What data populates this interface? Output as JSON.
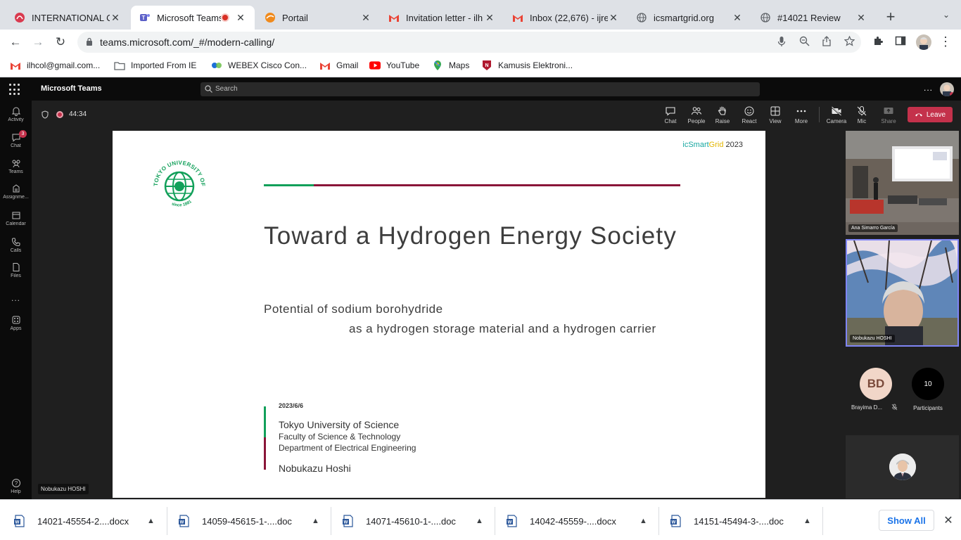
{
  "browser": {
    "tabs": [
      {
        "label": "INTERNATIONAL CO",
        "icon": "icsg-favicon",
        "active": false
      },
      {
        "label": "Microsoft Teams",
        "icon": "teams-favicon",
        "active": true
      },
      {
        "label": "Portail",
        "icon": "portail-favicon",
        "active": false
      },
      {
        "label": "Invitation letter - ilh",
        "icon": "gmail-favicon",
        "active": false
      },
      {
        "label": "Inbox (22,676) - ijre",
        "icon": "gmail-favicon",
        "active": false
      },
      {
        "label": "icsmartgrid.org",
        "icon": "globe-icon",
        "active": false
      },
      {
        "label": "#14021 Review",
        "icon": "globe-icon",
        "active": false
      }
    ],
    "url": "teams.microsoft.com/_#/modern-calling/",
    "bookmarks": [
      {
        "label": "ilhcol@gmail.com...",
        "icon": "gmail-icon"
      },
      {
        "label": "Imported From IE",
        "icon": "folder-icon"
      },
      {
        "label": "WEBEX Cisco Con...",
        "icon": "webex-icon"
      },
      {
        "label": "Gmail",
        "icon": "gmail-icon"
      },
      {
        "label": "YouTube",
        "icon": "youtube-icon"
      },
      {
        "label": "Maps",
        "icon": "maps-icon"
      },
      {
        "label": "Kamusis Elektroni...",
        "icon": "kamusis-icon"
      }
    ]
  },
  "teams": {
    "app_title": "Microsoft Teams",
    "search_placeholder": "Search",
    "more_label": "...",
    "rail": [
      {
        "label": "Activity",
        "icon": "bell-icon"
      },
      {
        "label": "Chat",
        "icon": "chat-icon",
        "badge": "3"
      },
      {
        "label": "Teams",
        "icon": "teams-icon"
      },
      {
        "label": "Assignme...",
        "icon": "assignments-icon"
      },
      {
        "label": "Calendar",
        "icon": "calendar-icon"
      },
      {
        "label": "Calls",
        "icon": "phone-icon"
      },
      {
        "label": "Files",
        "icon": "file-icon"
      },
      {
        "label": "...",
        "icon": "more-icon"
      },
      {
        "label": "Apps",
        "icon": "apps-icon"
      },
      {
        "label": "Help",
        "icon": "help-icon"
      }
    ]
  },
  "meeting": {
    "timer": "44:34",
    "controls": [
      {
        "label": "Chat",
        "icon": "chat-icon"
      },
      {
        "label": "People",
        "icon": "people-icon"
      },
      {
        "label": "Raise",
        "icon": "hand-icon"
      },
      {
        "label": "React",
        "icon": "smile-icon"
      },
      {
        "label": "View",
        "icon": "grid-icon"
      },
      {
        "label": "More",
        "icon": "more-icon"
      },
      {
        "label": "Camera",
        "icon": "camera-off-icon"
      },
      {
        "label": "Mic",
        "icon": "mic-off-icon"
      },
      {
        "label": "Share",
        "icon": "share-icon"
      }
    ],
    "leave_label": "Leave",
    "presenter_name": "Nobukazu HOSHI",
    "participants": [
      {
        "name": "Ana Simarro García"
      },
      {
        "name": "Nobukazu HOSHI"
      },
      {
        "name": "Brayima D...",
        "initials": "BD"
      }
    ],
    "participant_count": "10",
    "participants_label": "Participants"
  },
  "slide": {
    "conf_tag_a": "icSmart",
    "conf_tag_b": "Grid",
    "conf_tag_year": "2023",
    "logo_text": "TOKYO UNIVERSITY OF SCIENCE",
    "logo_since": "since 1881",
    "title": "Toward a Hydrogen Energy Society",
    "subtitle_line1": "Potential of sodium borohydride",
    "subtitle_line2": "as a hydrogen storage material and a hydrogen carrier",
    "date": "2023/6/6",
    "university": "Tokyo University of Science",
    "faculty": "Faculty of Science & Technology",
    "department": "Department of Electrical Engineering",
    "author": "Nobukazu Hoshi"
  },
  "downloads": {
    "items": [
      {
        "name": "14021-45554-2....docx"
      },
      {
        "name": "14059-45615-1-....doc"
      },
      {
        "name": "14071-45610-1-....doc"
      },
      {
        "name": "14042-45559-....docx"
      },
      {
        "name": "14151-45494-3-....doc"
      }
    ],
    "show_all_label": "Show All"
  }
}
